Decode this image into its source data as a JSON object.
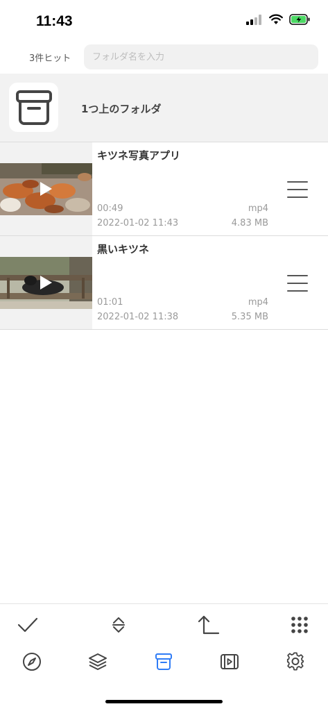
{
  "status_bar": {
    "time": "11:43"
  },
  "search": {
    "hit_count": "3件ヒット",
    "placeholder": "フォルダ名を入力",
    "value": ""
  },
  "parent_folder": {
    "label": "1つ上のフォルダ"
  },
  "videos": [
    {
      "title": "キツネ写真アプリ",
      "duration": "00:49",
      "format": "mp4",
      "date": "2022-01-02 11:43",
      "size": "4.83 MB"
    },
    {
      "title": "黒いキツネ",
      "duration": "01:01",
      "format": "mp4",
      "date": "2022-01-02 11:38",
      "size": "5.35 MB"
    }
  ],
  "toolbar": [
    "checkmark-icon",
    "sort-icon",
    "parent-folder-icon",
    "grid-icon"
  ],
  "tabs": [
    "compass-icon",
    "layers-icon",
    "archive-icon",
    "video-icon",
    "gear-icon"
  ],
  "colors": {
    "accent": "#2f7cf6",
    "icon": "#444444",
    "meta_text": "#9a9a9a",
    "battery": "#4cd964"
  }
}
